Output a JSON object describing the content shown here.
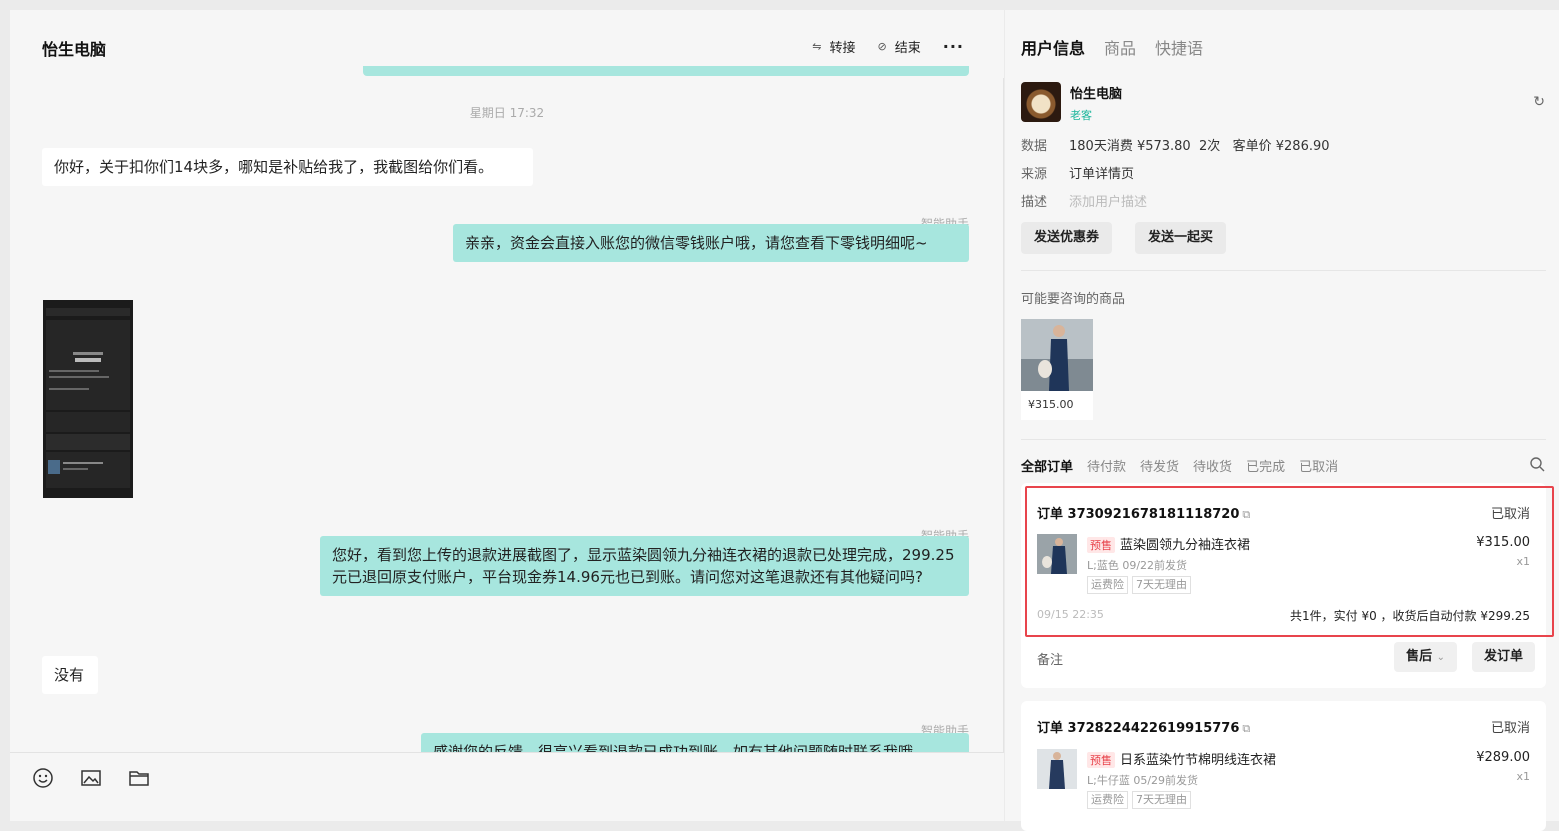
{
  "chat": {
    "title": "怡生电脑",
    "actions": {
      "transfer": "转接",
      "finish": "结束",
      "more": "···"
    },
    "timestamp": "星期日 17:32",
    "messages": [
      {
        "text": "你好，关于扣你们14块多，哪知是补贴给我了，我截图给你们看。"
      },
      {
        "sender": "智能助手",
        "text": "亲亲，资金会直接入账您的微信零钱账户哦，请您查看下零钱明细呢~"
      },
      {
        "sender": "智能助手",
        "text": "您好，看到您上传的退款进展截图了，显示蓝染圆领九分袖连衣裙的退款已处理完成，299.25元已退回原支付账户，平台现金券14.96元也已到账。请问您对这笔退款还有其他疑问吗?"
      },
      {
        "text": "没有"
      },
      {
        "sender": "智能助手",
        "text": "感谢您的反馈，很高兴看到退款已成功到账，如有其他问题随时联系我哦"
      }
    ],
    "screenshot": {
      "amount": "¥299.25"
    }
  },
  "panel": {
    "tabs": [
      "用户信息",
      "商品",
      "快捷语"
    ],
    "user": {
      "name": "怡生电脑",
      "tag": "老客"
    },
    "rows": {
      "data_label": "数据",
      "data_value": "180天消费 ¥573.80  2次   客单价 ¥286.90",
      "source_label": "来源",
      "source_value": "订单详情页",
      "desc_label": "描述",
      "desc_value": "添加用户描述"
    },
    "buttons": {
      "coupon": "发送优惠券",
      "group": "发送一起买"
    },
    "maybe_title": "可能要咨询的商品",
    "maybe_price": "¥315.00",
    "order_tabs": [
      "全部订单",
      "待付款",
      "待发货",
      "待收货",
      "已完成",
      "已取消"
    ],
    "orders": [
      {
        "no": "订单 3730921678181118720",
        "status": "已取消",
        "tag": "预售",
        "name": "蓝染圆领九分袖连衣裙",
        "sku": "L;蓝色  09/22前发货",
        "badges": [
          "运费险",
          "7天无理由"
        ],
        "price": "¥315.00",
        "qty": "x1",
        "time": "09/15 22:35",
        "summary": "共1件，实付 ¥0 ，收货后自动付款 ¥299.25",
        "note": "备注",
        "after_sale": "售后",
        "send": "发订单"
      },
      {
        "no": "订单 3728224422619915776",
        "status": "已取消",
        "tag": "预售",
        "name": "日系蓝染竹节棉明线连衣裙",
        "sku": "L;牛仔蓝  05/29前发货",
        "badges": [
          "运费险",
          "7天无理由"
        ],
        "price": "¥289.00",
        "qty": "x1"
      }
    ]
  },
  "colors": {
    "accent": "#a7e6de",
    "highlight": "#e8444c",
    "tag_green": "#19b59b"
  }
}
